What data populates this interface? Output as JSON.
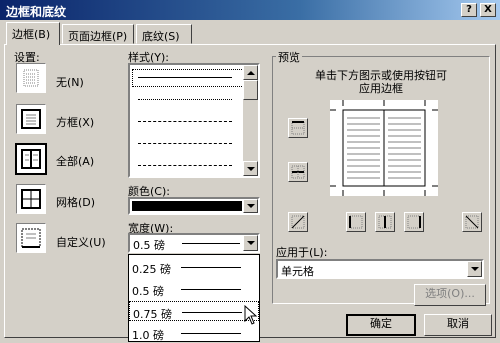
{
  "window": {
    "title": "边框和底纹",
    "help_label": "?",
    "close_label": "X"
  },
  "tabs": [
    {
      "label": "边框(B)",
      "active": true
    },
    {
      "label": "页面边框(P)",
      "active": false
    },
    {
      "label": "底纹(S)",
      "active": false
    }
  ],
  "settings": {
    "header": "设置:",
    "items": [
      {
        "label": "无(N)",
        "icon": "no-border-icon",
        "selected": false
      },
      {
        "label": "方框(X)",
        "icon": "box-border-icon",
        "selected": false
      },
      {
        "label": "全部(A)",
        "icon": "all-borders-icon",
        "selected": true
      },
      {
        "label": "网格(D)",
        "icon": "grid-border-icon",
        "selected": false
      },
      {
        "label": "自定义(U)",
        "icon": "custom-border-icon",
        "selected": false
      }
    ]
  },
  "style": {
    "header": "样式(Y):",
    "line_styles": [
      "solid",
      "dotted",
      "dashed",
      "dashed",
      "dashdot"
    ]
  },
  "color": {
    "header": "颜色(C):",
    "value_color": "#000000"
  },
  "width": {
    "header": "宽度(W):",
    "selected": "0.5 磅",
    "options": [
      "0.25 磅",
      "0.5 磅",
      "0.75 磅",
      "1.0 磅"
    ],
    "highlighted_index": 2
  },
  "preview": {
    "header": "预览",
    "hint_line1": "单击下方图示或使用按钮可",
    "hint_line2": "应用边框"
  },
  "apply_to": {
    "header": "应用于(L):",
    "value": "单元格"
  },
  "buttons": {
    "options": "选项(O)...",
    "ok": "确定",
    "cancel": "取消"
  }
}
